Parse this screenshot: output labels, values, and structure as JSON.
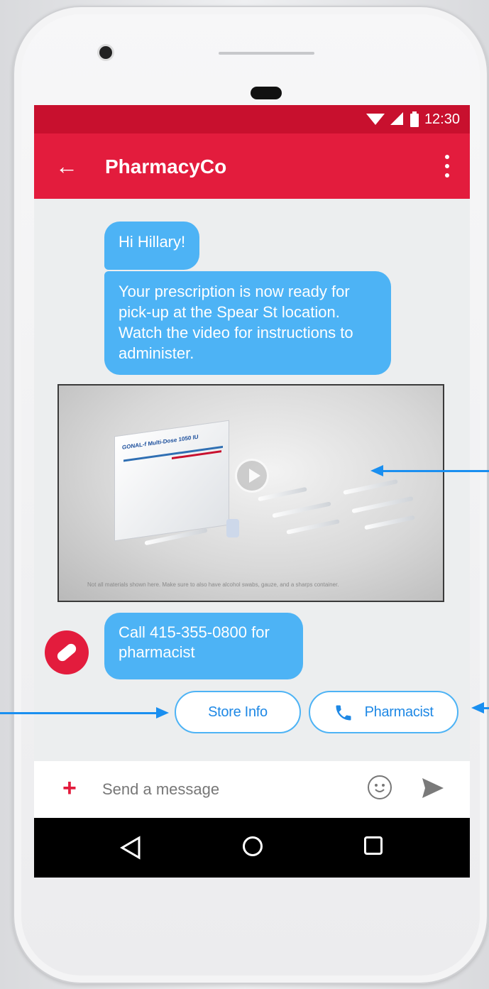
{
  "status_bar": {
    "time": "12:30"
  },
  "app_bar": {
    "title": "PharmacyCo",
    "back_icon": "arrow-left-icon",
    "menu_icon": "more-vert-icon"
  },
  "messages": [
    {
      "text": "Hi Hillary!"
    },
    {
      "text": "Your prescription is now ready for pick-up at the Spear St location. Watch the video for instructions to administer."
    },
    {
      "text": "Call 415-355-0800 for pharmacist"
    }
  ],
  "video": {
    "caption": "Not all materials shown here. Make sure to also have alcohol swabs, gauze, and a sharps container.",
    "box_label": "GONAL-f Multi-Dose 1050 IU"
  },
  "suggestions": [
    {
      "label": "Store Info"
    },
    {
      "label": "Pharmacist",
      "icon": "phone-icon"
    }
  ],
  "composer": {
    "placeholder": "Send a message",
    "add_icon": "plus-icon",
    "emoji_icon": "emoji-icon",
    "send_icon": "send-icon"
  },
  "colors": {
    "brand_red": "#e31c3d",
    "status_red": "#c8102e",
    "bubble_blue": "#4db3f5",
    "chip_text": "#1e88e5",
    "annotation_arrow": "#1a8ff0"
  }
}
